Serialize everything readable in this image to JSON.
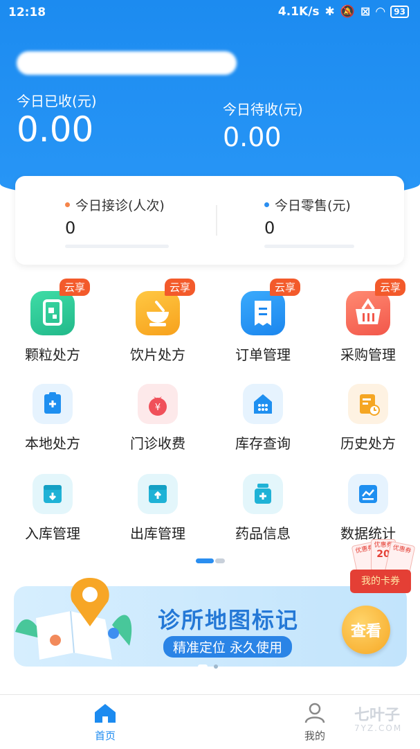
{
  "status": {
    "time": "12:18",
    "speed": "4.1K/s",
    "battery": "93"
  },
  "summary": {
    "received_label": "今日已收(元)",
    "received_value": "0.00",
    "pending_label": "今日待收(元)",
    "pending_value": "0.00"
  },
  "stats": {
    "visits_label": "今日接诊(人次)",
    "visits_value": "0",
    "retail_label": "今日零售(元)",
    "retail_value": "0",
    "visits_dot_color": "#f5854a",
    "retail_dot_color": "#2a8ef0"
  },
  "grid": {
    "badge": "云享",
    "items": [
      {
        "label": "颗粒处方",
        "icon": "granule-prescription-icon"
      },
      {
        "label": "饮片处方",
        "icon": "herbal-slices-icon"
      },
      {
        "label": "订单管理",
        "icon": "order-receipt-icon"
      },
      {
        "label": "采购管理",
        "icon": "shopping-basket-icon"
      },
      {
        "label": "本地处方",
        "icon": "clipboard-plus-icon"
      },
      {
        "label": "门诊收费",
        "icon": "money-bag-icon"
      },
      {
        "label": "库存查询",
        "icon": "warehouse-icon"
      },
      {
        "label": "历史处方",
        "icon": "history-document-icon"
      },
      {
        "label": "入库管理",
        "icon": "inbox-in-icon"
      },
      {
        "label": "出库管理",
        "icon": "inbox-out-icon"
      },
      {
        "label": "药品信息",
        "icon": "medicine-bottle-icon"
      },
      {
        "label": "数据统计",
        "icon": "chart-line-icon"
      }
    ]
  },
  "banner": {
    "title": "诊所地图标记",
    "subtitle": "精准定位 永久使用",
    "button": "查看"
  },
  "coupon": {
    "label": "我的卡券",
    "ticket_text": "优惠券",
    "amount": "20"
  },
  "tabbar": {
    "home": "首页",
    "mine": "我的"
  },
  "watermark": {
    "text": "七叶子",
    "sub": "7YZ.COM"
  },
  "colors": {
    "primary": "#1c8bf0",
    "badge": "#f35a2b"
  }
}
